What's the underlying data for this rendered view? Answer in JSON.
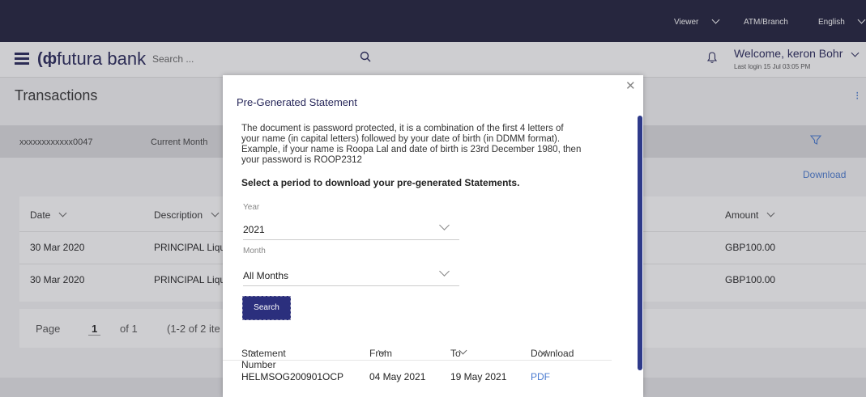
{
  "topbar": {
    "viewer_label": "Viewer",
    "atm_branch": "ATM/Branch",
    "language": "English"
  },
  "header": {
    "brand": "futura bank",
    "search_placeholder": "Search ...",
    "welcome": "Welcome, keron Bohr",
    "last_login": "Last login 15 Jul 03:05 PM"
  },
  "page": {
    "title": "Transactions",
    "account": "xxxxxxxxxxxx0047",
    "period": "Current Month",
    "download_label": "Download",
    "columns": [
      "Date",
      "Description",
      "Amount"
    ],
    "rows": [
      {
        "date": "30 Mar 2020",
        "description": "PRINCIPAL Liqu",
        "amount": "GBP100.00"
      },
      {
        "date": "30 Mar 2020",
        "description": "PRINCIPAL Liqu",
        "amount": "GBP100.00"
      }
    ],
    "pager": {
      "page_label": "Page",
      "page_num": "1",
      "of_label": "of 1",
      "items": "(1-2 of 2 ite"
    }
  },
  "modal": {
    "title": "Pre-Generated Statement",
    "description_lines": [
      "The document is password protected, it is a combination of the first 4 letters of",
      "your name (in capital letters) followed by your date of birth (in DDMM format).",
      "Example, if your name is Roopa Lal and date of birth is 23rd December 1980, then",
      "your password is ROOP2312"
    ],
    "prompt": "Select a period to download your pre-generated Statements.",
    "year_label": "Year",
    "year_value": "2021",
    "month_label": "Month",
    "month_value": "All Months",
    "search_button": "Search",
    "table_headers": [
      "Statement Number",
      "From",
      "To",
      "Download"
    ],
    "rows": [
      {
        "number": "HELMSOG200901OCP",
        "from": "04 May 2021",
        "to": "19 May 2021",
        "download": "PDF"
      }
    ]
  },
  "colors": {
    "primary": "#27275a",
    "topbar": "#1f1f3b",
    "link": "#4a7bd0",
    "button": "#2b2f7d"
  }
}
